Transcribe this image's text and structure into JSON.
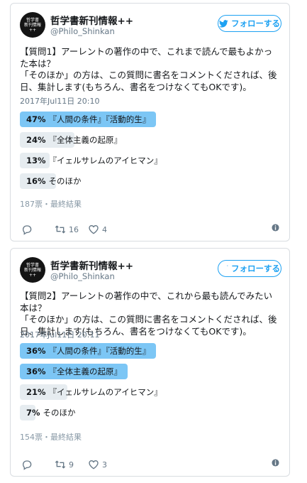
{
  "tweets": [
    {
      "avatar": {
        "line1": "哲学書",
        "line2": "新刊情報",
        "line3": "++"
      },
      "name": "哲学書新刊情報++",
      "handle": "@Philo_Shinkan",
      "follow_label": "フォローする",
      "text": "【質問1】アーレントの著作の中で、これまで読んで最もよかった本は？\n「そのほか」の方は、この質問に書名をコメントくだされば、後日、集計します(もちろん、書名をつけなくてもOKです)。",
      "timestamp": "2017年Jul11日 20:10",
      "poll": [
        {
          "pct": "47%",
          "label": "『人間の条件』『活動的生』",
          "fraction": 0.47,
          "winner": true
        },
        {
          "pct": "24%",
          "label": "『全体主義の起原』",
          "fraction": 0.24,
          "winner": false
        },
        {
          "pct": "13%",
          "label": "『イェルサレムのアイヒマン』",
          "fraction": 0.13,
          "winner": false
        },
        {
          "pct": "16%",
          "label": "そのほか",
          "fraction": 0.16,
          "winner": false
        }
      ],
      "votes": "187票・最終結果",
      "reply_count": "",
      "retweet_count": "16",
      "like_count": "4"
    },
    {
      "avatar": {
        "line1": "哲学書",
        "line2": "新刊情報",
        "line3": "++"
      },
      "name": "哲学書新刊情報++",
      "handle": "@Philo_Shinkan",
      "follow_label": "フォローする",
      "text": "【質問2】アーレントの著作の中で、これから最も読んでみたい本は？\n「そのほか」の方は、この質問に書名をコメントくだされば、後日、集計します(もちろん、書名をつけなくてもOKです)。",
      "timestamp": "2017年Jul11日 20:11",
      "poll": [
        {
          "pct": "36%",
          "label": "『人間の条件』『活動的生』",
          "fraction": 0.36,
          "winner": true
        },
        {
          "pct": "36%",
          "label": "『全体主義の起原』",
          "fraction": 0.36,
          "winner": true
        },
        {
          "pct": "21%",
          "label": "『イェルサレムのアイヒマン』",
          "fraction": 0.21,
          "winner": false
        },
        {
          "pct": "7%",
          "label": "そのほか",
          "fraction": 0.07,
          "winner": false
        }
      ],
      "votes": "154票・最終結果",
      "reply_count": "",
      "retweet_count": "9",
      "like_count": "3"
    }
  ],
  "colors": {
    "accent": "#1da1f2",
    "poll_winner": "#7cc6f5",
    "poll_other": "#e6ecf0"
  },
  "icons": [
    "twitter-bird-icon",
    "reply-icon",
    "retweet-icon",
    "heart-icon",
    "info-icon"
  ]
}
